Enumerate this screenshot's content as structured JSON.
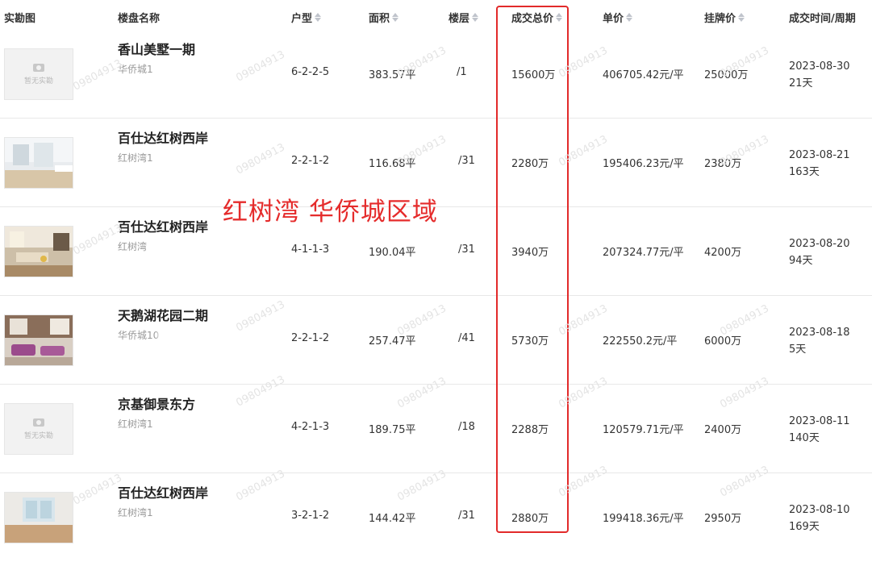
{
  "headers": {
    "photo": "实勘图",
    "name": "楼盘名称",
    "layout": "户型",
    "area": "面积",
    "floor": "楼层",
    "total": "成交总价",
    "unit": "单价",
    "list": "挂牌价",
    "time": "成交时间/周期"
  },
  "placeholder_text": "暂无实勘",
  "annotation": "红树湾 华侨城区域",
  "watermark": "09804913",
  "highlight_color": "#e22a2a",
  "rows": [
    {
      "name": "香山美墅一期",
      "sub": "华侨城1",
      "layout": "6-2-2-5",
      "area": "383.57平",
      "floor": "/1",
      "total": "15600万",
      "unit": "406705.42元/平",
      "list": "25000万",
      "date": "2023-08-30",
      "cycle": "21天"
    },
    {
      "name": "百仕达红树西岸",
      "sub": "红树湾1",
      "layout": "2-2-1-2",
      "area": "116.68平",
      "floor": "/31",
      "total": "2280万",
      "unit": "195406.23元/平",
      "list": "2380万",
      "date": "2023-08-21",
      "cycle": "163天"
    },
    {
      "name": "百仕达红树西岸",
      "sub": "红树湾",
      "layout": "4-1-1-3",
      "area": "190.04平",
      "floor": "/31",
      "total": "3940万",
      "unit": "207324.77元/平",
      "list": "4200万",
      "date": "2023-08-20",
      "cycle": "94天"
    },
    {
      "name": "天鹅湖花园二期",
      "sub": "华侨城10",
      "layout": "2-2-1-2",
      "area": "257.47平",
      "floor": "/41",
      "total": "5730万",
      "unit": "222550.2元/平",
      "list": "6000万",
      "date": "2023-08-18",
      "cycle": "5天"
    },
    {
      "name": "京基御景东方",
      "sub": "红树湾1",
      "layout": "4-2-1-3",
      "area": "189.75平",
      "floor": "/18",
      "total": "2288万",
      "unit": "120579.71元/平",
      "list": "2400万",
      "date": "2023-08-11",
      "cycle": "140天"
    },
    {
      "name": "百仕达红树西岸",
      "sub": "红树湾1",
      "layout": "3-2-1-2",
      "area": "144.42平",
      "floor": "/31",
      "total": "2880万",
      "unit": "199418.36元/平",
      "list": "2950万",
      "date": "2023-08-10",
      "cycle": "169天"
    }
  ]
}
